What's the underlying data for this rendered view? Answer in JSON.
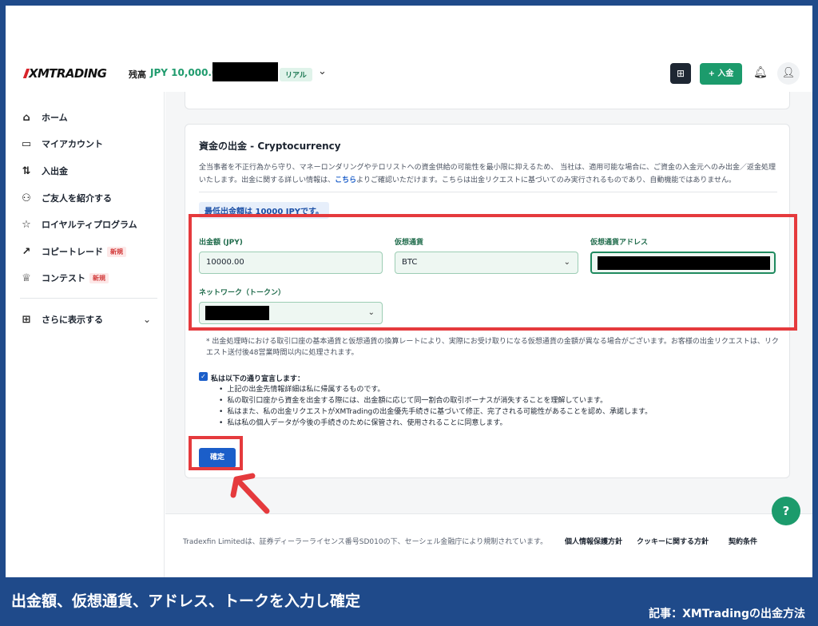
{
  "header": {
    "logo": "XMTRADING",
    "balance_label": "残高",
    "balance_value": "JPY 10,000.00",
    "account_badge": "リアル",
    "deposit_label": "+ 入金"
  },
  "sidebar": {
    "items": [
      {
        "label": "ホーム",
        "icon": "home-icon"
      },
      {
        "label": "マイアカウント",
        "icon": "card-icon"
      },
      {
        "label": "入出金",
        "icon": "transfer-icon"
      },
      {
        "label": "ご友人を紹介する",
        "icon": "friends-icon"
      },
      {
        "label": "ロイヤルティプログラム",
        "icon": "star-icon"
      },
      {
        "label": "コピートレード",
        "icon": "trend-icon",
        "badge": "新規"
      },
      {
        "label": "コンテスト",
        "icon": "trophy-icon",
        "badge": "新規"
      }
    ],
    "more_label": "さらに表示する"
  },
  "withdrawal": {
    "title": "資金の出金 - Cryptocurrency",
    "desc_before": "全当事者を不正行為から守り、マネーロンダリングやテロリストへの資金供給の可能性を最小限に抑えるため、 当社は、適用可能な場合に、ご資金の入金元へのみ出金／返金処理いたします。出金に関する詳しい情報は、",
    "desc_link": "こちら",
    "desc_after": "よりご確認いただけます。こちらは出金リクエストに基づいてのみ実行されるものであり、自動機能ではありません。",
    "min_notice": "最低出金額は 10000 JPYです。",
    "amount_label": "出金額 (JPY)",
    "amount_value": "10000.00",
    "currency_label": "仮想通貨",
    "currency_value": "BTC",
    "address_label": "仮想通貨アドレス",
    "network_label": "ネットワーク（トークン）",
    "note": "* 出金処理時における取引口座の基本通貨と仮想通貨の換算レートにより、実際にお受け取りになる仮想通貨の金額が異なる場合がございます。お客様の出金リクエストは、リクエスト送付後48営業時間以内に処理されます。",
    "declare_label": "私は以下の通り宣言します：",
    "declare_items": [
      "上記の出金先情報詳細は私に帰属するものです。",
      "私の取引口座から資金を出金する際には、出金額に応じて同一割合の取引ボーナスが消失することを理解しています。",
      "私はまた、私の出金リクエストがXMTradingの出金優先手続きに基づいて修正、完了される可能性があることを認め、承諾します。",
      "私は私の個人データが今後の手続きのために保管され、使用されることに同意します。"
    ],
    "confirm_label": "確定"
  },
  "footer": {
    "text": "Tradexfin Limitedは、証券ディーラーライセンス番号SD010の下、セーシェル金融庁により規制されています。",
    "links": [
      "個人情報保護方針",
      "クッキーに関する方針",
      "契約条件"
    ]
  },
  "caption": "出金額、仮想通貨、アドレス、トークを入力し確定",
  "credit": "記事：XMTradingの出金方法",
  "colors": {
    "accent_green": "#1c9b6c",
    "primary_blue": "#1b5ec9",
    "highlight_red": "#e53a3d",
    "banner_blue": "#1f4a8a"
  }
}
